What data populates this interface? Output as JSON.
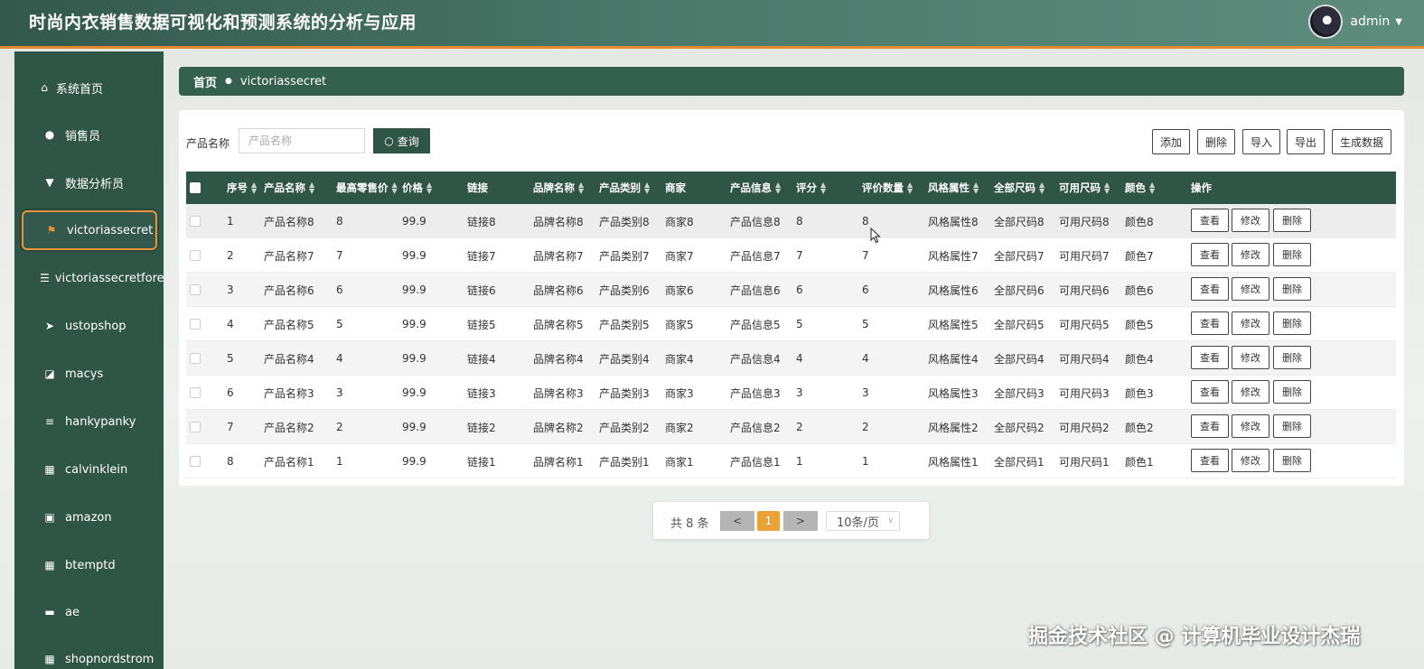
{
  "header": {
    "title": "时尚内衣销售数据可视化和预测系统的分析与应用",
    "username": "admin"
  },
  "sidebar": {
    "items": [
      {
        "label": "系统首页",
        "icon": "home-icon"
      },
      {
        "label": "销售员",
        "icon": "user-icon"
      },
      {
        "label": "数据分析员",
        "icon": "pin-icon"
      },
      {
        "label": "victoriassecret",
        "icon": "flag-icon",
        "active": true
      },
      {
        "label": "victoriassecretforecast",
        "icon": "list-icon"
      },
      {
        "label": "ustopshop",
        "icon": "send-icon"
      },
      {
        "label": "macys",
        "icon": "chart-icon"
      },
      {
        "label": "hankypanky",
        "icon": "menu-icon"
      },
      {
        "label": "calvinklein",
        "icon": "grid-icon"
      },
      {
        "label": "amazon",
        "icon": "clipboard-icon"
      },
      {
        "label": "btemptd",
        "icon": "grid-icon"
      },
      {
        "label": "ae",
        "icon": "ticket-icon"
      },
      {
        "label": "shopnordstrom",
        "icon": "grid-icon"
      }
    ]
  },
  "breadcrumb": {
    "home": "首页",
    "current": "victoriassecret"
  },
  "search": {
    "label": "产品名称",
    "placeholder": "产品名称",
    "button": "查询"
  },
  "toolbar": {
    "add": "添加",
    "delete": "删除",
    "import": "导入",
    "export": "导出",
    "generate": "生成数据"
  },
  "table": {
    "columns": [
      "序号",
      "产品名称",
      "最高零售价",
      "价格",
      "链接",
      "品牌名称",
      "产品类别",
      "商家",
      "产品信息",
      "评分",
      "评价数量",
      "风格属性",
      "全部尺码",
      "可用尺码",
      "颜色",
      "操作"
    ],
    "rows": [
      [
        "1",
        "产品名称8",
        "8",
        "99.9",
        "链接8",
        "品牌名称8",
        "产品类别8",
        "商家8",
        "产品信息8",
        "8",
        "8",
        "风格属性8",
        "全部尺码8",
        "可用尺码8",
        "颜色8"
      ],
      [
        "2",
        "产品名称7",
        "7",
        "99.9",
        "链接7",
        "品牌名称7",
        "产品类别7",
        "商家7",
        "产品信息7",
        "7",
        "7",
        "风格属性7",
        "全部尺码7",
        "可用尺码7",
        "颜色7"
      ],
      [
        "3",
        "产品名称6",
        "6",
        "99.9",
        "链接6",
        "品牌名称6",
        "产品类别6",
        "商家6",
        "产品信息6",
        "6",
        "6",
        "风格属性6",
        "全部尺码6",
        "可用尺码6",
        "颜色6"
      ],
      [
        "4",
        "产品名称5",
        "5",
        "99.9",
        "链接5",
        "品牌名称5",
        "产品类别5",
        "商家5",
        "产品信息5",
        "5",
        "5",
        "风格属性5",
        "全部尺码5",
        "可用尺码5",
        "颜色5"
      ],
      [
        "5",
        "产品名称4",
        "4",
        "99.9",
        "链接4",
        "品牌名称4",
        "产品类别4",
        "商家4",
        "产品信息4",
        "4",
        "4",
        "风格属性4",
        "全部尺码4",
        "可用尺码4",
        "颜色4"
      ],
      [
        "6",
        "产品名称3",
        "3",
        "99.9",
        "链接3",
        "品牌名称3",
        "产品类别3",
        "商家3",
        "产品信息3",
        "3",
        "3",
        "风格属性3",
        "全部尺码3",
        "可用尺码3",
        "颜色3"
      ],
      [
        "7",
        "产品名称2",
        "2",
        "99.9",
        "链接2",
        "品牌名称2",
        "产品类别2",
        "商家2",
        "产品信息2",
        "2",
        "2",
        "风格属性2",
        "全部尺码2",
        "可用尺码2",
        "颜色2"
      ],
      [
        "8",
        "产品名称1",
        "1",
        "99.9",
        "链接1",
        "品牌名称1",
        "产品类别1",
        "商家1",
        "产品信息1",
        "1",
        "1",
        "风格属性1",
        "全部尺码1",
        "可用尺码1",
        "颜色1"
      ]
    ],
    "actions": {
      "view": "查看",
      "edit": "修改",
      "delete": "删除"
    }
  },
  "pagination": {
    "total": "共 8 条",
    "prev": "<",
    "current": "1",
    "next": ">",
    "page_size": "10条/页"
  },
  "watermark": "掘金技术社区 @ 计算机毕业设计杰瑞",
  "colors": {
    "primary": "#2f5547",
    "accent": "#e8953a",
    "page_active": "#eba234"
  }
}
